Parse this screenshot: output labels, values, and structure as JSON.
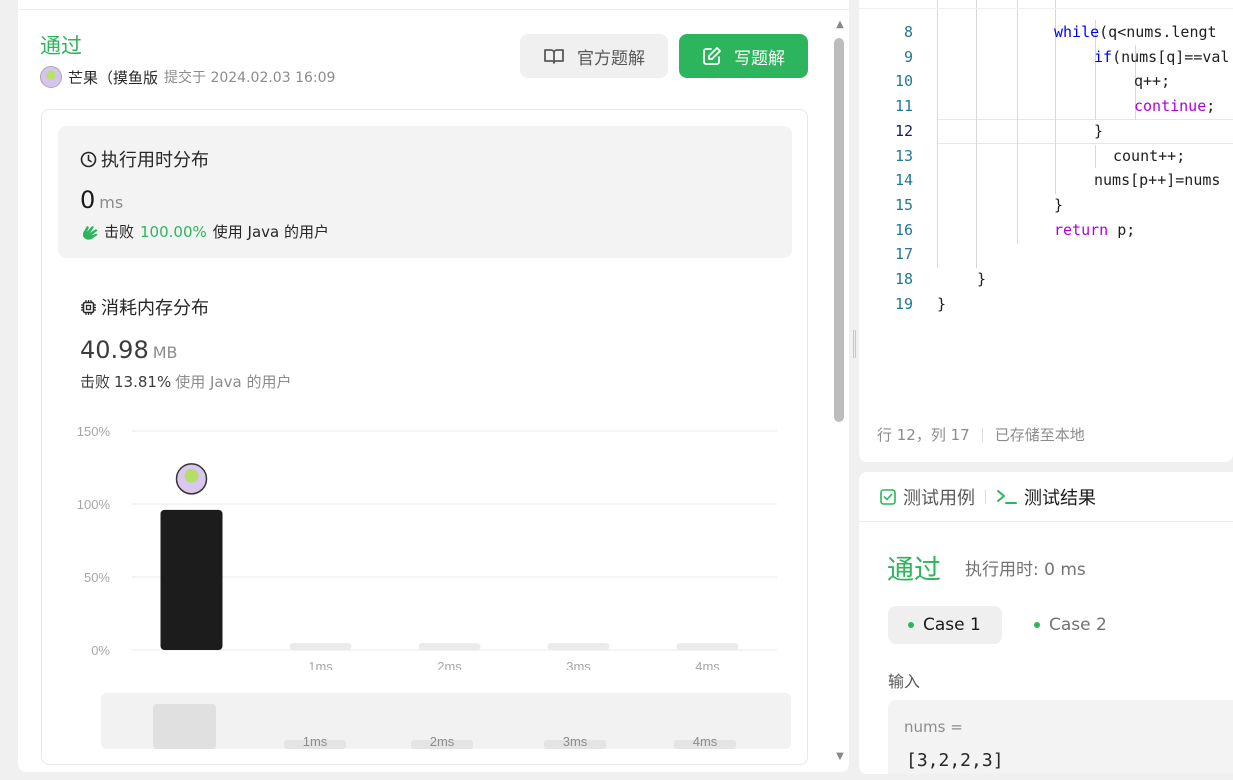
{
  "submission": {
    "status": "通过",
    "user": "芒果（摸鱼版",
    "submit_text": "提交于 2024.02.03 16:09",
    "official_solution_label": "官方题解",
    "write_solution_label": "写题解"
  },
  "runtime": {
    "title": "执行用时分布",
    "value": "0",
    "unit": "ms",
    "beat_prefix": "击败",
    "beat_percent": "100.00%",
    "beat_suffix": "使用 Java 的用户"
  },
  "memory": {
    "title": "消耗内存分布",
    "value": "40.98",
    "unit": "MB",
    "beat_prefix": "击败",
    "beat_percent": "13.81%",
    "beat_suffix": "使用 Java 的用户"
  },
  "chart_data": {
    "type": "bar",
    "categories": [
      "",
      "1ms",
      "2ms",
      "3ms",
      "4ms"
    ],
    "values": [
      96,
      0,
      0,
      0,
      0
    ],
    "ylim": [
      0,
      150
    ],
    "yticks": [
      "0%",
      "50%",
      "100%",
      "150%"
    ],
    "ytick_values": [
      0,
      50,
      100,
      150
    ],
    "highlight_index": 0,
    "highlight_color": "#1c1c1c",
    "bar_color": "#ebebeb",
    "mini_categories": [
      "1ms",
      "2ms",
      "3ms",
      "4ms"
    ]
  },
  "editor": {
    "lines": [
      {
        "num": "8",
        "text": "while(q<nums.lengt",
        "cls": "kw-blue-word"
      },
      {
        "num": "9",
        "text": "if(nums[q]==val",
        "cls": "kw-blue-word"
      },
      {
        "num": "10",
        "text": "q++;",
        "cls": ""
      },
      {
        "num": "11",
        "text": "continue;",
        "cls": "kw-purple-all"
      },
      {
        "num": "12",
        "text": "}",
        "cls": ""
      },
      {
        "num": "13",
        "text": "count++;",
        "cls": ""
      },
      {
        "num": "14",
        "text": "nums[p++]=nums",
        "cls": ""
      },
      {
        "num": "15",
        "text": "}",
        "cls": ""
      },
      {
        "num": "16",
        "text": "return p;",
        "cls": "kw-purple-word"
      },
      {
        "num": "17",
        "text": "",
        "cls": ""
      },
      {
        "num": "18",
        "text": "}",
        "cls": ""
      },
      {
        "num": "19",
        "text": "}",
        "cls": ""
      }
    ],
    "cursor_position": "行 12，列 17",
    "save_status": "已存储至本地"
  },
  "results": {
    "tab_cases": "测试用例",
    "tab_results": "测试结果",
    "status": "通过",
    "runtime": "执行用时: 0 ms",
    "case1": "Case 1",
    "case2": "Case 2",
    "input_label": "输入",
    "input_name": "nums =",
    "input_value": "[3,2,2,3]"
  },
  "colors": {
    "accent_green": "#2db55d",
    "line_number": "#237893",
    "keyword_blue": "#0000ff",
    "keyword_purple": "#af00db"
  }
}
